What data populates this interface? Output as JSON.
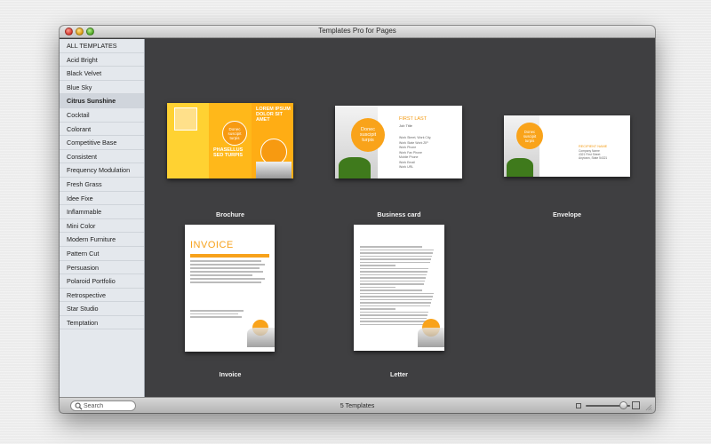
{
  "window": {
    "title": "Templates Pro for Pages"
  },
  "sidebar": {
    "items": [
      {
        "label": "ALL TEMPLATES"
      },
      {
        "label": "Acid Bright"
      },
      {
        "label": "Black Velvet"
      },
      {
        "label": "Blue Sky"
      },
      {
        "label": "Citrus Sunshine",
        "selected": true
      },
      {
        "label": "Cocktail"
      },
      {
        "label": "Colorant"
      },
      {
        "label": "Competitive Base"
      },
      {
        "label": "Consistent"
      },
      {
        "label": "Frequency Modulation"
      },
      {
        "label": "Fresh Grass"
      },
      {
        "label": "Idee Fixe"
      },
      {
        "label": "Inflammable"
      },
      {
        "label": "Mini Color"
      },
      {
        "label": "Modern Furniture"
      },
      {
        "label": "Pattern Cut"
      },
      {
        "label": "Persuasion"
      },
      {
        "label": "Polaroid Portfolio"
      },
      {
        "label": "Retrospective"
      },
      {
        "label": "Star Studio"
      },
      {
        "label": "Temptation"
      }
    ]
  },
  "templates": [
    {
      "label": "Brochure",
      "headline": "LOREM IPSUM DOLOR SIT AMET",
      "subheading": "PHASELLUS SED TURPIS",
      "circle_text": "Donec suscipit turpis"
    },
    {
      "label": "Business card",
      "name": "FIRST LAST",
      "job_title": "Job Title",
      "lines": [
        "Work Street, Work City,",
        "Work State Work ZIP",
        "Work Phone",
        "Work Fax Phone",
        "Mobile Phone",
        "Work Email",
        "Work URL"
      ],
      "circle_text": "Donec suscipit turpis"
    },
    {
      "label": "Envelope",
      "recipient_name": "RECIPIENT NAME",
      "recipient_lines": [
        "Company Name",
        "4321 First Street",
        "Anytown, State 54321"
      ],
      "circle_text": "Donec suscipit turpis"
    },
    {
      "label": "Invoice",
      "heading": "INVOICE"
    },
    {
      "label": "Letter"
    }
  ],
  "bottombar": {
    "search_placeholder": "Search",
    "status": "5 Templates",
    "zoom_level": 0.85
  },
  "colors": {
    "accent_orange": "#f7a21b",
    "accent_yellow": "#ffc21a",
    "content_bg": "#3f3f41",
    "sidebar_bg": "#e4e8ed"
  }
}
